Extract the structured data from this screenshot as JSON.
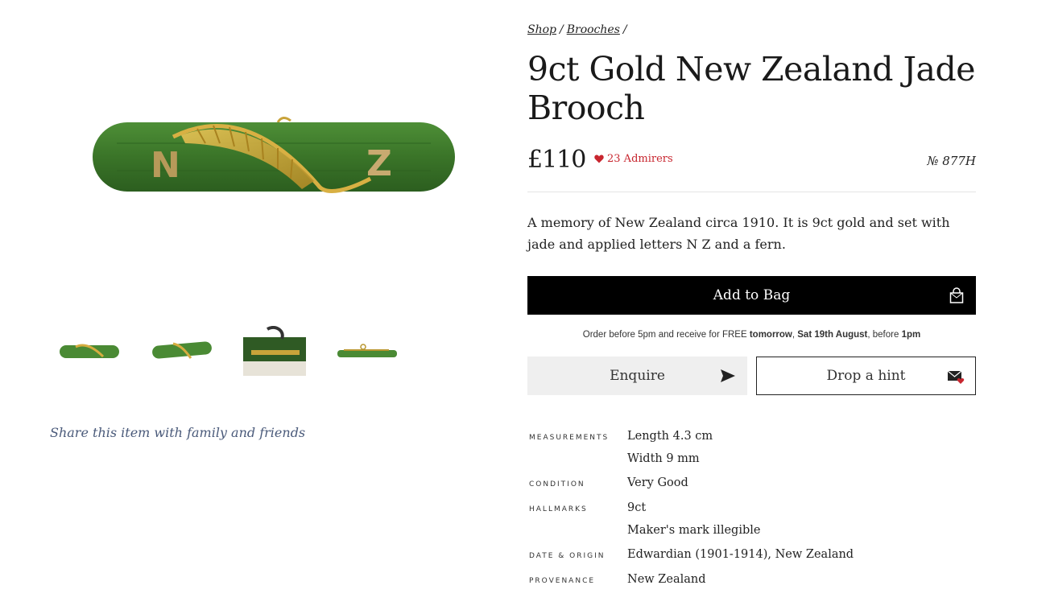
{
  "breadcrumb": {
    "shop": "Shop",
    "sep1": "/",
    "brooches": "Brooches",
    "sep2": "/"
  },
  "product": {
    "title": "9ct Gold New Zealand Jade Brooch",
    "price": "£110",
    "admirers": "23 Admirers",
    "reference": "№ 877H",
    "description": "A memory of New Zealand circa 1910. It is 9ct gold and set with jade and applied letters N Z and a fern."
  },
  "actions": {
    "add_to_bag": "Add to Bag",
    "enquire": "Enquire",
    "drop_hint": "Drop a hint"
  },
  "delivery": {
    "part1": "Order before 5pm and receive for FREE ",
    "tomorrow": "tomorrow",
    "comma": ", ",
    "date": "Sat 19th August",
    "part2": ", before ",
    "time": "1pm"
  },
  "share": "Share this item with family and friends",
  "image_letters": {
    "left": "N",
    "right": "Z"
  },
  "specs": {
    "measurements_label": "Measurements",
    "length": "Length 4.3 cm",
    "width": "Width 9 mm",
    "condition_label": "Condition",
    "condition": "Very Good",
    "hallmarks_label": "Hallmarks",
    "hallmark1": "9ct",
    "hallmark2": "Maker's mark illegible",
    "date_label": "Date & Origin",
    "date": "Edwardian (1901-1914), New Zealand",
    "provenance_label": "Provenance",
    "provenance": "New Zealand"
  },
  "colors": {
    "jade": "#3f7a2c",
    "gold": "#c9a33a",
    "accent_red": "#c8262f",
    "share_blue": "#4a5a7a"
  },
  "icons": {
    "heart": "heart-icon",
    "bag": "bag-icon",
    "send": "send-icon",
    "mail": "mail-heart-icon"
  }
}
